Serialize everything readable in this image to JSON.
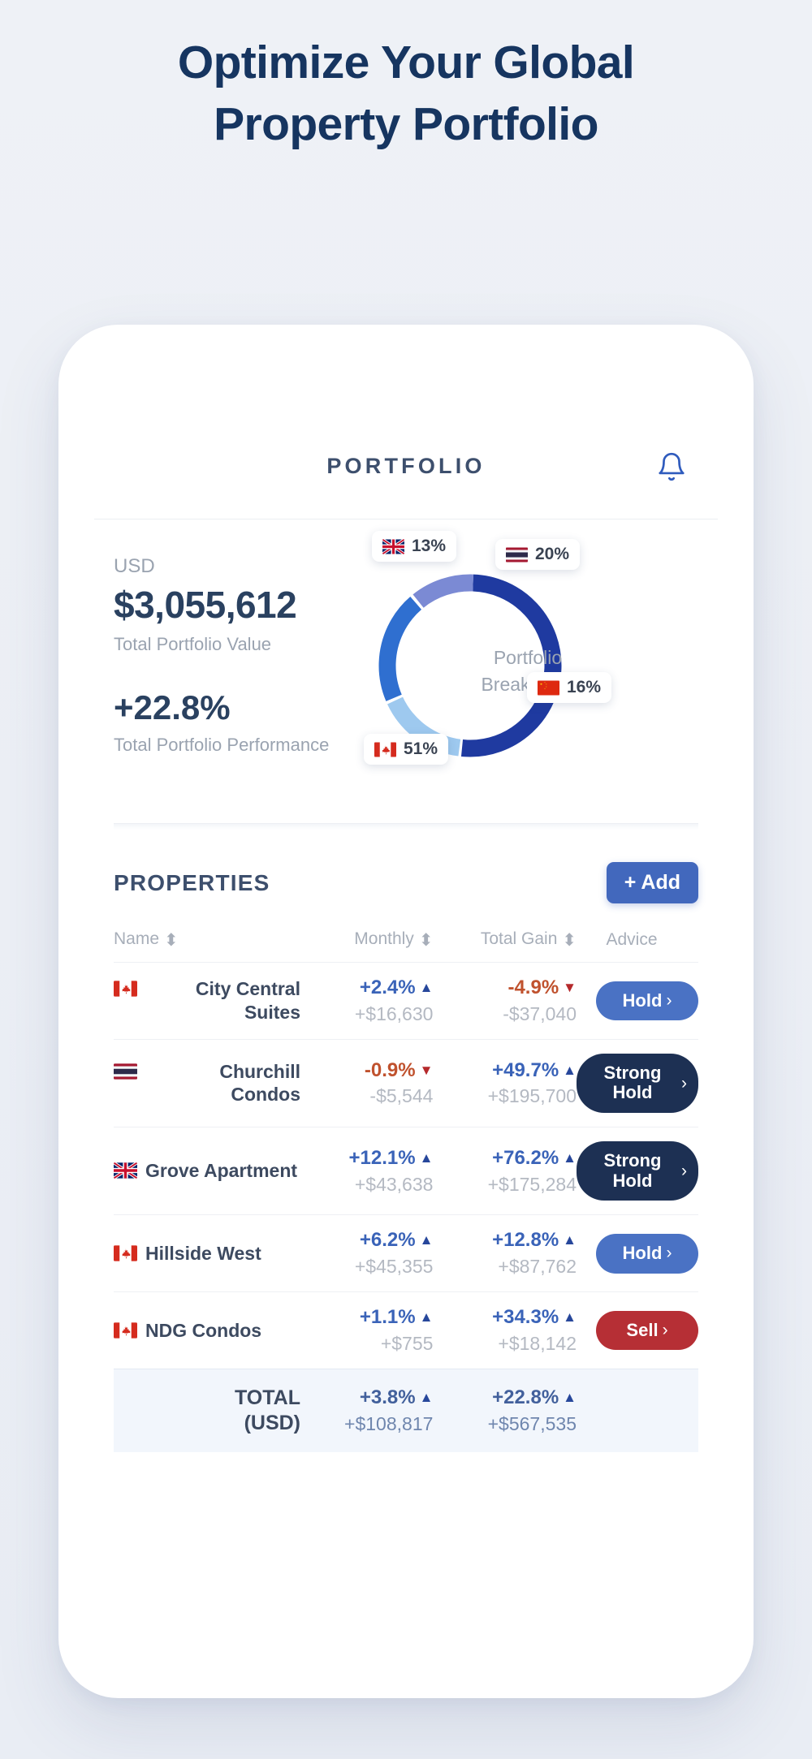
{
  "hero": {
    "line1": "Optimize Your Global",
    "line2": "Property Portfolio"
  },
  "app": {
    "title": "PORTFOLIO",
    "bell_icon": "bell-icon"
  },
  "summary": {
    "currency": "USD",
    "total_value": "$3,055,612",
    "total_value_label": "Total Portfolio Value",
    "performance": "+22.8%",
    "performance_label": "Total Portfolio Performance"
  },
  "chart_data": {
    "type": "pie",
    "title": "Portfolio Breakdown",
    "center_line1": "Portfolio",
    "center_line2": "Breakdown",
    "categories": [
      "Canada",
      "United Kingdom",
      "Thailand",
      "China"
    ],
    "labels": [
      "51%",
      "13%",
      "20%",
      "16%"
    ],
    "values": [
      51,
      13,
      20,
      16
    ],
    "colors": [
      "#1f3aa0",
      "#7b8ad4",
      "#2f6fd0",
      "#9ec9ef"
    ],
    "flags": [
      "ca",
      "gb",
      "th",
      "cn"
    ],
    "legend": "chips-on-arc"
  },
  "properties": {
    "title": "PROPERTIES",
    "add_label": "+ Add",
    "columns": [
      "Name",
      "Monthly",
      "Total Gain",
      "Advice"
    ],
    "rows": [
      {
        "flag": "ca",
        "name": "City Central Suites",
        "monthly_pct": "+2.4%",
        "monthly_dir": "up",
        "monthly_amt": "+$16,630",
        "total_pct": "-4.9%",
        "total_dir": "down",
        "total_amt": "-$37,040",
        "advice": "Hold",
        "advice_style": "hold"
      },
      {
        "flag": "th",
        "name": "Churchill Condos",
        "monthly_pct": "-0.9%",
        "monthly_dir": "down",
        "monthly_amt": "-$5,544",
        "total_pct": "+49.7%",
        "total_dir": "up",
        "total_amt": "+$195,700",
        "advice": "Strong Hold",
        "advice_style": "strong"
      },
      {
        "flag": "gb",
        "name": "Grove Apartment",
        "monthly_pct": "+12.1%",
        "monthly_dir": "up",
        "monthly_amt": "+$43,638",
        "total_pct": "+76.2%",
        "total_dir": "up",
        "total_amt": "+$175,284",
        "advice": "Strong Hold",
        "advice_style": "strong"
      },
      {
        "flag": "ca",
        "name": "Hillside West",
        "monthly_pct": "+6.2%",
        "monthly_dir": "up",
        "monthly_amt": "+$45,355",
        "total_pct": "+12.8%",
        "total_dir": "up",
        "total_amt": "+$87,762",
        "advice": "Hold",
        "advice_style": "hold"
      },
      {
        "flag": "ca",
        "name": "NDG Condos",
        "monthly_pct": "+1.1%",
        "monthly_dir": "up",
        "monthly_amt": "+$755",
        "total_pct": "+34.3%",
        "total_dir": "up",
        "total_amt": "+$18,142",
        "advice": "Sell",
        "advice_style": "sell"
      }
    ],
    "total_row": {
      "label_line1": "TOTAL",
      "label_line2": "(USD)",
      "monthly_pct": "+3.8%",
      "monthly_dir": "up",
      "monthly_amt": "+$108,817",
      "total_pct": "+22.8%",
      "total_dir": "up",
      "total_amt": "+$567,535"
    }
  },
  "colors": {
    "headline": "#163560",
    "accent_blue": "#4268bd",
    "up": "#3a63b8",
    "down": "#c0522e",
    "strong_hold": "#1d3053",
    "sell": "#b62f35",
    "page_bg": "#eef1f6"
  }
}
